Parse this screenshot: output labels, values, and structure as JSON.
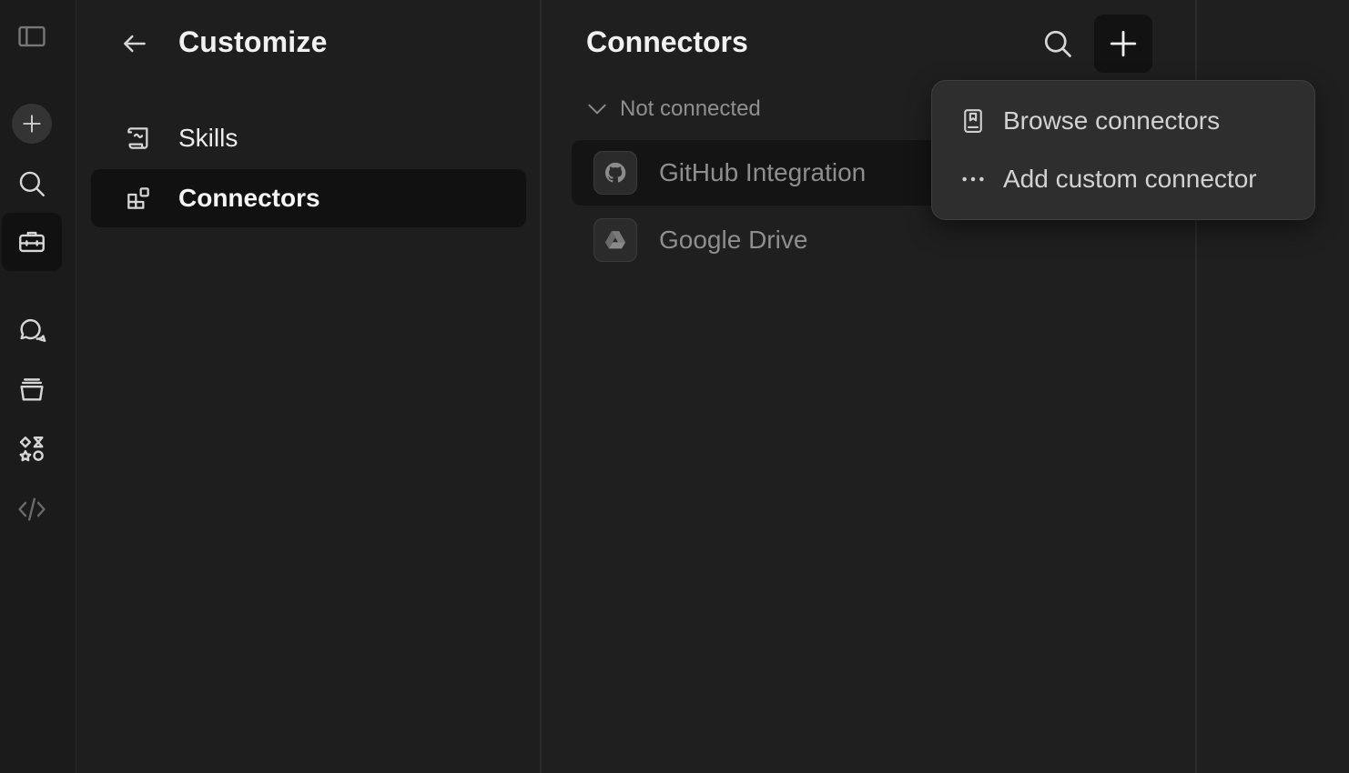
{
  "rail": {
    "items": [
      {
        "icon": "sidebar-toggle-icon"
      },
      {
        "icon": "plus-icon"
      },
      {
        "icon": "search-icon"
      },
      {
        "icon": "toolbox-icon"
      },
      {
        "icon": "chat-bubbles-icon"
      },
      {
        "icon": "stack-icon"
      },
      {
        "icon": "shapes-icon"
      },
      {
        "icon": "code-icon"
      }
    ]
  },
  "customize": {
    "back_icon": "arrow-left-icon",
    "title": "Customize",
    "nav": [
      {
        "label": "Skills",
        "icon": "scroll-icon",
        "active": false
      },
      {
        "label": "Connectors",
        "icon": "blocks-icon",
        "active": true
      }
    ]
  },
  "connectors": {
    "title": "Connectors",
    "search_icon": "search-icon",
    "add_icon": "plus-icon",
    "section": {
      "label": "Not connected",
      "icon": "chevron-down-icon",
      "items": [
        {
          "name": "GitHub Integration",
          "icon": "github-icon"
        },
        {
          "name": "Google Drive",
          "icon": "google-drive-icon"
        }
      ]
    }
  },
  "menu": {
    "items": [
      {
        "label": "Browse connectors",
        "icon": "book-icon"
      },
      {
        "label": "Add custom connector",
        "icon": "more-horizontal-icon"
      }
    ]
  },
  "colors": {
    "background": "#1f1f1f",
    "rail": "#1b1b1b",
    "active_item": "#111111",
    "menu": "#2e2e2e",
    "text_primary": "#ececec",
    "text_muted": "#8e8e8e"
  }
}
